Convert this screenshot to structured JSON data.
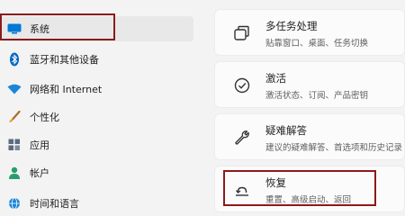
{
  "sidebar": {
    "items": [
      {
        "label": "系统",
        "icon": "monitor-icon",
        "selected": true
      },
      {
        "label": "蓝牙和其他设备",
        "icon": "bluetooth-icon"
      },
      {
        "label": "网络和 Internet",
        "icon": "wifi-icon"
      },
      {
        "label": "个性化",
        "icon": "brush-icon"
      },
      {
        "label": "应用",
        "icon": "apps-icon"
      },
      {
        "label": "帐户",
        "icon": "person-icon"
      },
      {
        "label": "时间和语言",
        "icon": "globe-icon"
      }
    ]
  },
  "main": {
    "cards": [
      {
        "title": "多任务处理",
        "desc": "贴靠窗口、桌面、任务切换",
        "icon": "multitask-icon"
      },
      {
        "title": "激活",
        "desc": "激活状态、订阅、产品密钥",
        "icon": "check-circle-icon"
      },
      {
        "title": "疑难解答",
        "desc": "建议的疑难解答、首选项和历史记录",
        "icon": "wrench-icon"
      },
      {
        "title": "恢复",
        "desc": "重置、高级启动、返回",
        "icon": "recovery-icon"
      }
    ]
  },
  "colors": {
    "highlight": "#8b1a1a",
    "accent": "#0067c0"
  }
}
